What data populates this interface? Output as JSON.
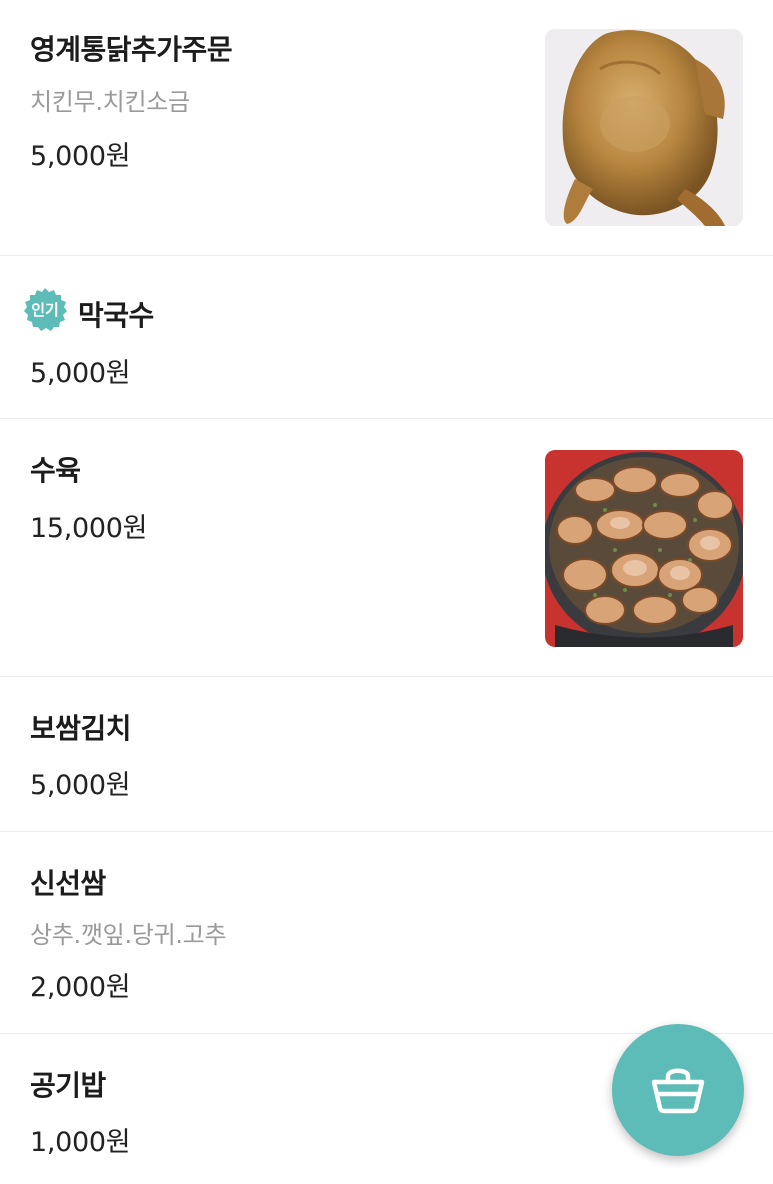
{
  "menu": {
    "items": [
      {
        "name": "영계통닭추가주문",
        "description": "치킨무.치킨소금",
        "price": "5,000원",
        "photo": "whole-roasted-chicken"
      },
      {
        "name": "막국수",
        "badge": "인기",
        "price": "5,000원"
      },
      {
        "name": "수육",
        "price": "15,000원",
        "photo": "sliced-boiled-pork"
      },
      {
        "name": "보쌈김치",
        "price": "5,000원"
      },
      {
        "name": "신선쌈",
        "description": "상추.깻잎.당귀.고추",
        "price": "2,000원"
      },
      {
        "name": "공기밥",
        "price": "1,000원"
      }
    ]
  },
  "cart_button": {
    "icon": "shopping-basket-icon",
    "color": "#5dbcb8"
  },
  "badge_color": "#5dbcb8"
}
